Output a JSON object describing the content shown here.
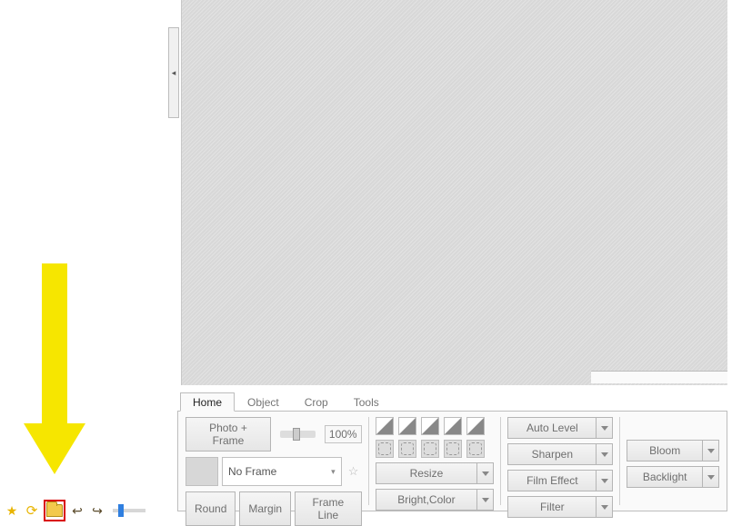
{
  "tabs": [
    "Home",
    "Object",
    "Crop",
    "Tools"
  ],
  "activeTab": "Home",
  "photoFrame": {
    "btn": "Photo + Frame",
    "zoom": "100%",
    "selectLabel": "No Frame",
    "round": "Round",
    "margin": "Margin",
    "frameLine": "Frame Line"
  },
  "col2": {
    "resize": "Resize",
    "brightColor": "Bright,Color"
  },
  "col3": {
    "autoLevel": "Auto Level",
    "sharpen": "Sharpen",
    "filmEffect": "Film Effect",
    "filter": "Filter"
  },
  "col4": {
    "bloom": "Bloom",
    "backlight": "Backlight"
  },
  "icons": {
    "collapse": "◂",
    "chevDown": "▾",
    "star": "★",
    "rotate": "⟳",
    "back": "↩",
    "fwd": "↪"
  }
}
